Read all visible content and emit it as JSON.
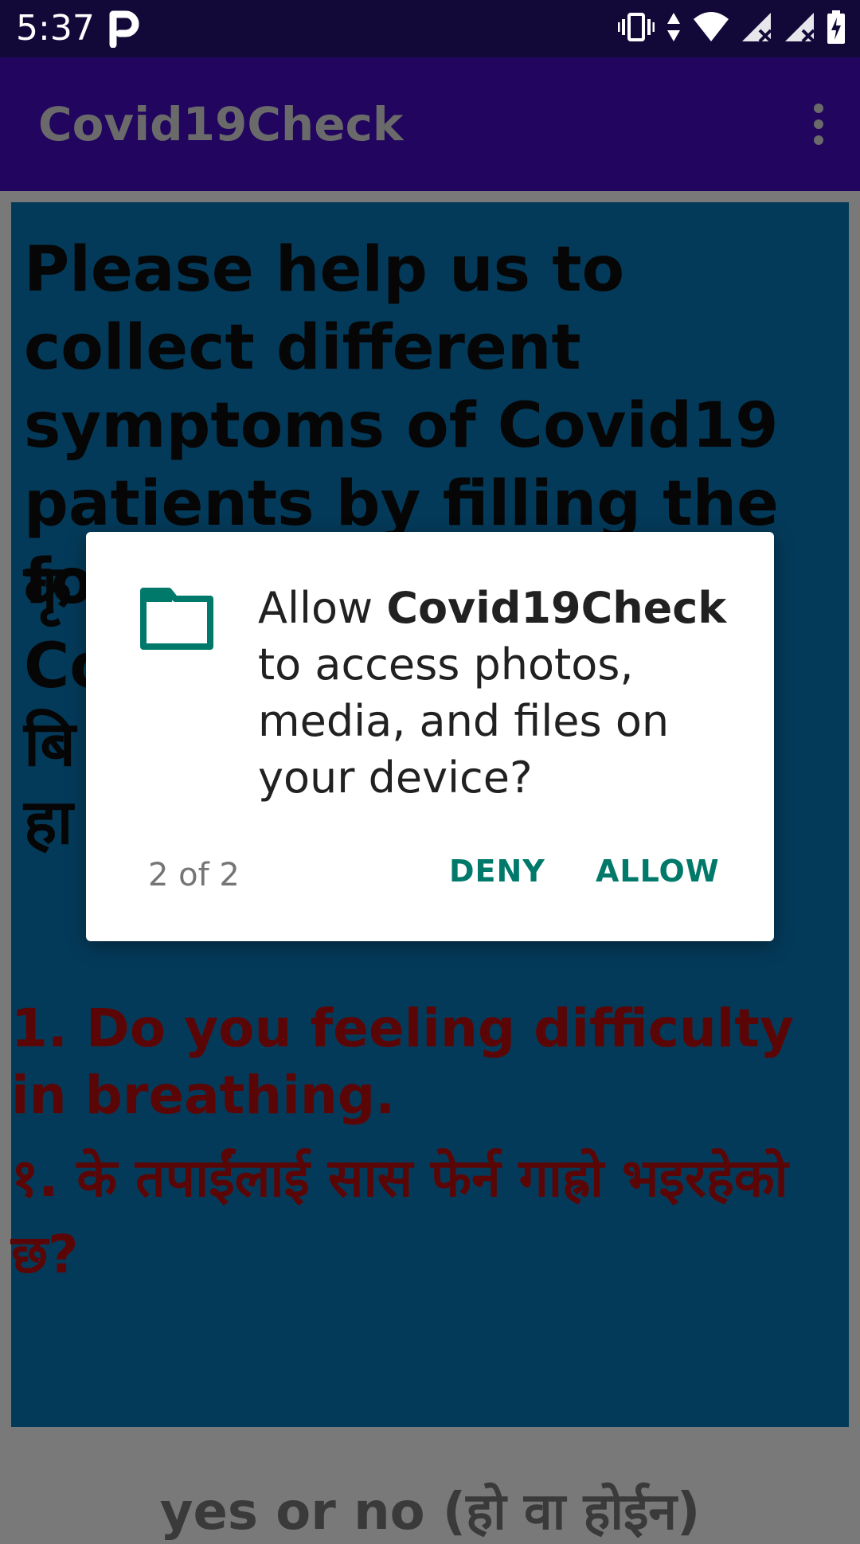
{
  "status_bar": {
    "time": "5:37",
    "notification_icon": "parking-p-icon",
    "system_icons": [
      "vibrate-icon",
      "data-arrows-icon",
      "wifi-icon",
      "signal-no-service-icon",
      "signal-no-service-icon",
      "battery-charging-icon"
    ]
  },
  "app_bar": {
    "title": "Covid19Check",
    "overflow_icon": "more-vert-icon",
    "background": "#21055f"
  },
  "content": {
    "intro_en": "Please help us to collect different symptoms of Covid19 patients by filling the form below:",
    "intro_np_visible_fragments": [
      "कृ",
      "Co",
      "बि",
      "हा"
    ],
    "question_en": "1. Do you feeling difficulty in breathing.",
    "question_np": "१. के तपाईंलाई सास फेर्न गाह्रो भइरहेको छ?",
    "answer_hint": "yes or no (हो वा होईन)",
    "background": "#043a59"
  },
  "dialog": {
    "icon": "folder-icon",
    "message_prefix": "Allow ",
    "app_name": "Covid19Check",
    "message_suffix": "to access photos, media, and files on your device?",
    "counter": "2 of 2",
    "deny_label": "DENY",
    "allow_label": "ALLOW",
    "accent": "#00796b"
  }
}
